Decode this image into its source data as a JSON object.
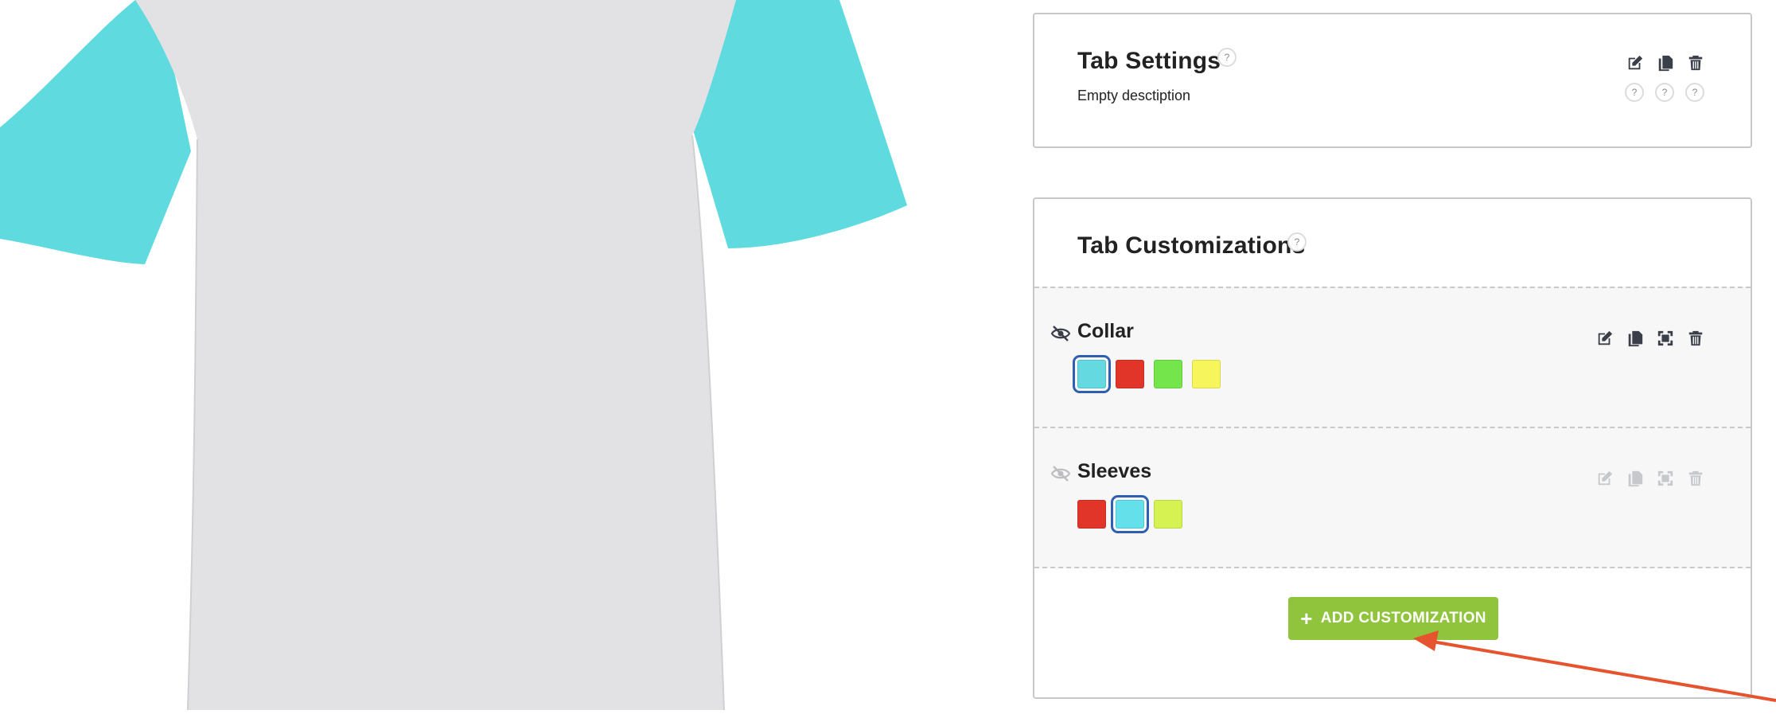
{
  "settings": {
    "title": "Tab Settings",
    "help_icon": "?",
    "description": "Empty desctiption",
    "action_icons": [
      "edit-icon",
      "copy-icon",
      "trash-icon"
    ],
    "action_help": [
      "?",
      "?",
      "?"
    ]
  },
  "customizations": {
    "title": "Tab Customizations",
    "help_icon": "?",
    "items": [
      {
        "name": "Collar",
        "visibility_icon": "eye-slash-icon",
        "swatches": [
          "#64d9df",
          "#e1352a",
          "#74e64c",
          "#f6f55c"
        ],
        "selected_index": 0,
        "actions": [
          "edit-icon",
          "copy-icon",
          "crop-icon",
          "trash-icon"
        ],
        "actions_enabled": true
      },
      {
        "name": "Sleeves",
        "visibility_icon": "eye-slash-icon",
        "swatches": [
          "#e1352a",
          "#64e0ea",
          "#d6f252"
        ],
        "selected_index": 1,
        "actions": [
          "edit-icon",
          "copy-icon",
          "crop-icon",
          "trash-icon"
        ],
        "actions_enabled": false
      }
    ],
    "add_button": {
      "icon": "+",
      "label": "ADD CUSTOMIZATION",
      "color": "#8fc43c"
    }
  },
  "preview": {
    "shirt_body_color": "#e2e2e4",
    "shirt_sleeve_color": "#5fdbe0"
  },
  "annotation_arrow_color": "#e5532f"
}
